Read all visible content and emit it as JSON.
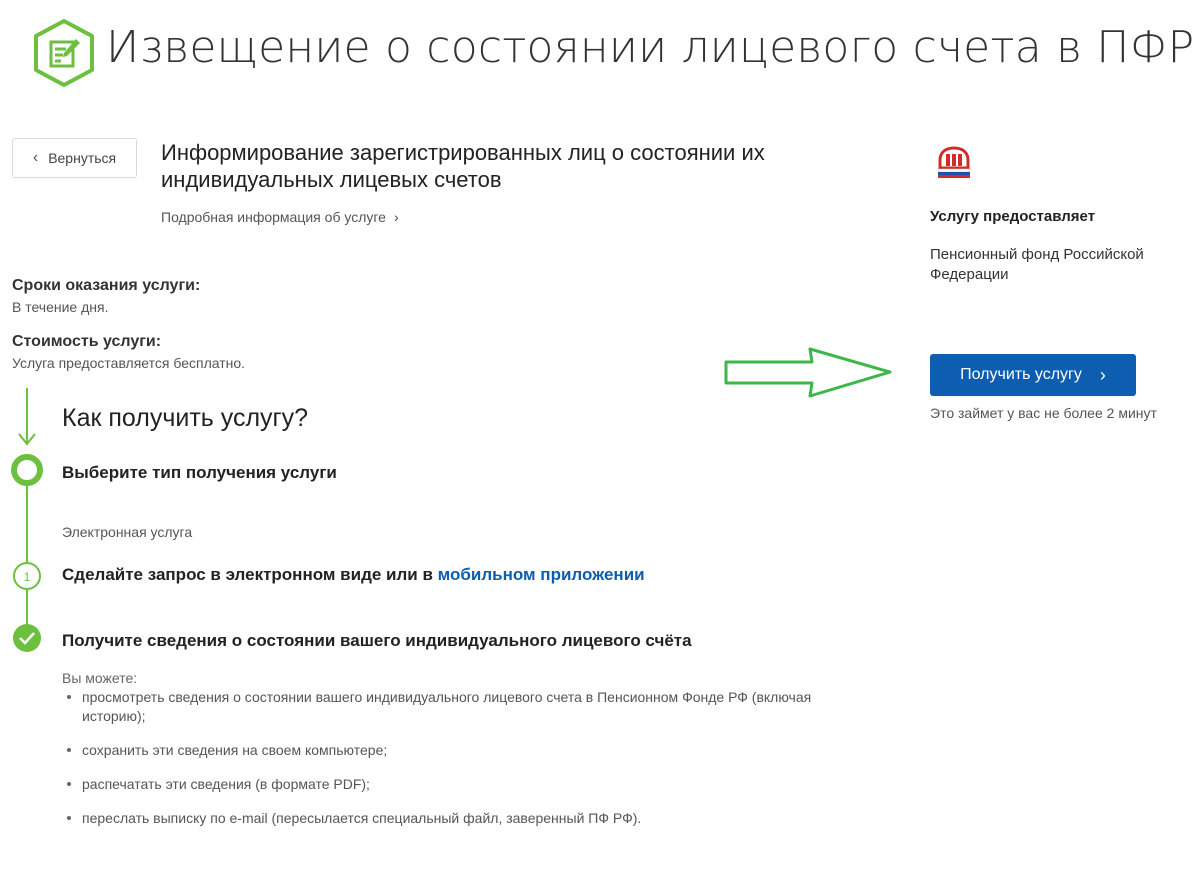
{
  "header": {
    "title": "Извещение о состоянии лицевого счета в ПФР",
    "icon": "edit-document-icon",
    "accent_color": "#6cbf3f"
  },
  "nav": {
    "back_label": "Вернуться"
  },
  "service": {
    "title": "Информирование зарегистрированных лиц о состоянии их индивидуальных лицевых счетов",
    "details_link": "Подробная информация об услуге",
    "term_label": "Сроки оказания услуги:",
    "term_value": "В течение дня.",
    "cost_label": "Стоимость услуги:",
    "cost_value": "Услуга предоставляется бесплатно."
  },
  "how": {
    "title": "Как получить услугу?",
    "steps": [
      {
        "title": "Выберите тип получения услуги",
        "subtitle": "Электронная услуга"
      },
      {
        "number": "1",
        "title_prefix": "Сделайте запрос в электронном виде или в ",
        "title_link": "мобильном приложении"
      },
      {
        "title": "Получите сведения о состоянии вашего индивидуального лицевого счёта"
      }
    ],
    "can_label": "Вы можете:",
    "can_items": [
      "просмотреть сведения о состоянии вашего индивидуального лицевого счета в Пенсионном Фонде РФ (включая историю);",
      "сохранить эти сведения на своем компьютере;",
      "распечатать эти сведения (в формате PDF);",
      "переслать выписку по e-mail (пересылается специальный файл, заверенный ПФ РФ)."
    ]
  },
  "provider": {
    "heading": "Услугу предоставляет",
    "name": "Пенсионный фонд Российской Федерации",
    "logo": "pfr-logo-icon"
  },
  "action": {
    "button_label": "Получить услугу",
    "time_note": "Это займет у вас не более 2 минут",
    "button_color": "#0d5db0"
  }
}
